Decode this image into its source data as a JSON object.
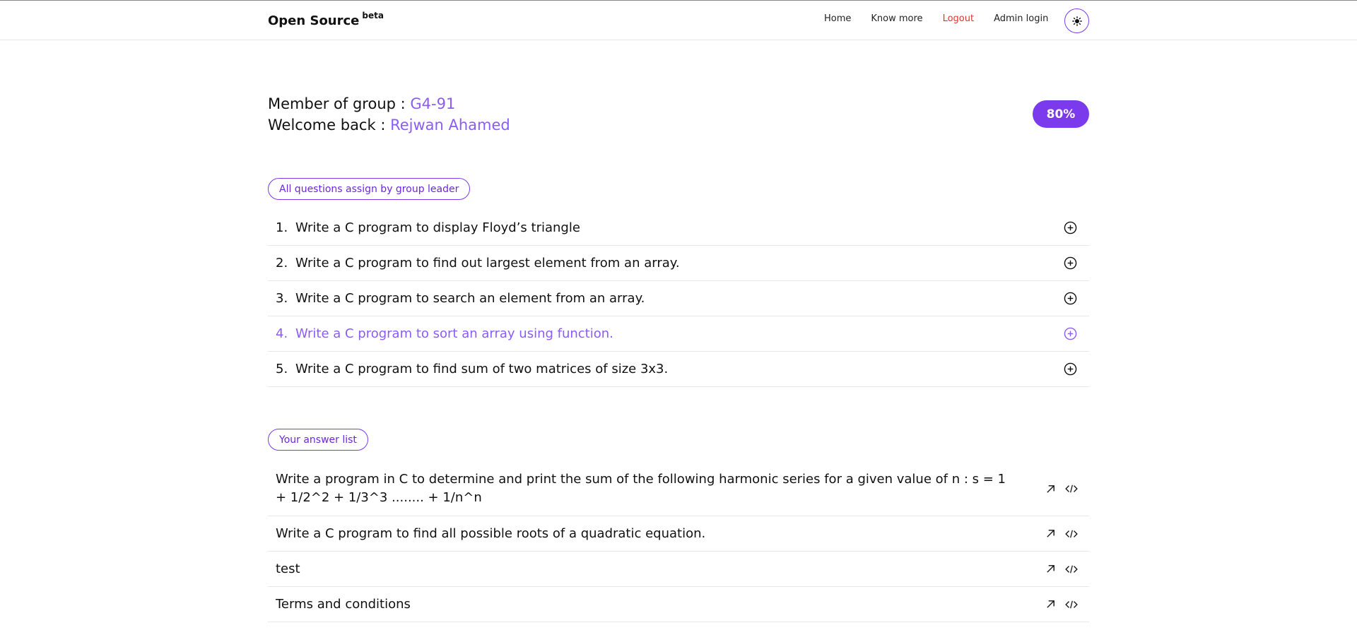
{
  "header": {
    "brand": "Open Source",
    "brand_badge": "beta",
    "nav": [
      {
        "label": "Home"
      },
      {
        "label": "Know more"
      },
      {
        "label": "Logout"
      },
      {
        "label": "Admin login"
      }
    ],
    "theme_icon": "sun-icon"
  },
  "welcome": {
    "group_label": "Member of group : ",
    "group_value": "G4-91",
    "welcome_label": "Welcome back : ",
    "user_name": "Rejwan Ahamed",
    "progress": "80%"
  },
  "questions": {
    "pill": "All questions assign by group leader",
    "items": [
      {
        "num": "1.",
        "text": "Write a C program to display Floyd’s triangle"
      },
      {
        "num": "2.",
        "text": "Write a C program to find out largest element from an array."
      },
      {
        "num": "3.",
        "text": "Write a C program to search an element from an array."
      },
      {
        "num": "4.",
        "text": "Write a C program to sort an array using function."
      },
      {
        "num": "5.",
        "text": "Write a C program to find sum of two matrices of size 3x3."
      }
    ]
  },
  "answers": {
    "pill": "Your answer list",
    "items": [
      {
        "text": "Write a program in C to determine and print the sum of the following harmonic series for a given value of n : s = 1 + 1/2^2 + 1/3^3 ........ + 1/n^n"
      },
      {
        "text": "Write a C program to find all possible roots of a quadratic equation."
      },
      {
        "text": "test"
      },
      {
        "text": "Terms and conditions"
      }
    ]
  },
  "colors": {
    "accent": "#7c3aed",
    "accent_light": "#8b5cf6",
    "logout": "#e0322b"
  }
}
